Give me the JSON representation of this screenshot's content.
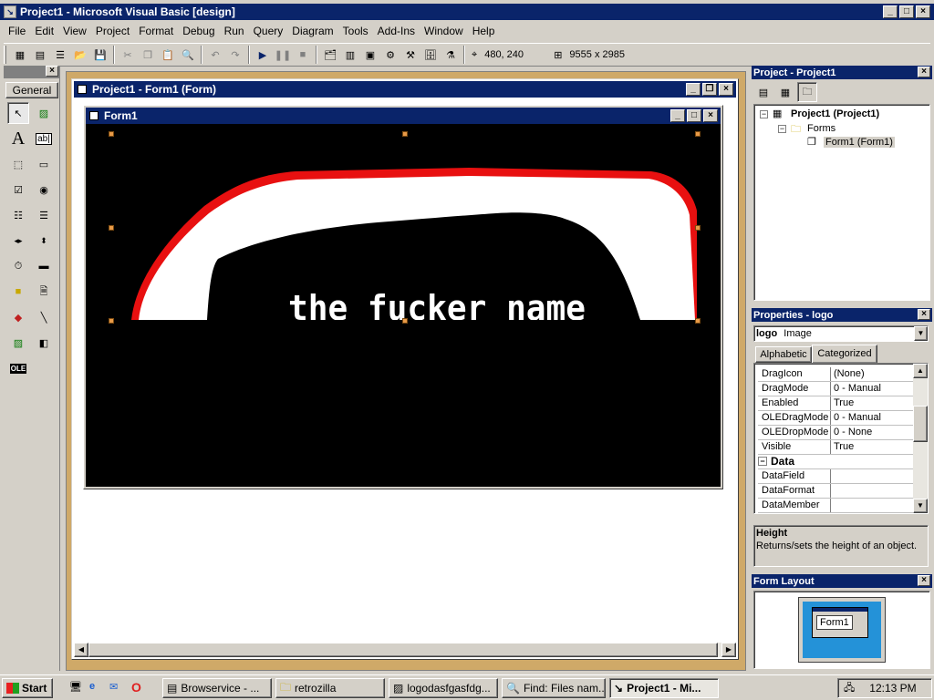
{
  "app": {
    "title": "Project1 - Microsoft Visual Basic [design]"
  },
  "menu": [
    "File",
    "Edit",
    "View",
    "Project",
    "Format",
    "Debug",
    "Run",
    "Query",
    "Diagram",
    "Tools",
    "Add-Ins",
    "Window",
    "Help"
  ],
  "toolbar": {
    "position": "480, 240",
    "size": "9555 x 2985"
  },
  "toolbox": {
    "tab_label": "General"
  },
  "project_window": {
    "title": "Project1 - Form1 (Form)",
    "form_title": "Form1",
    "logo_text": "the fucker name"
  },
  "project_explorer": {
    "title": "Project - Project1",
    "root": "Project1 (Project1)",
    "folder": "Forms",
    "form": "Form1 (Form1)"
  },
  "properties": {
    "title": "Properties - logo",
    "object_name": "logo",
    "object_type": "Image",
    "tab_alpha": "Alphabetic",
    "tab_cat": "Categorized",
    "rows": [
      {
        "name": "DragIcon",
        "value": "(None)"
      },
      {
        "name": "DragMode",
        "value": "0 - Manual"
      },
      {
        "name": "Enabled",
        "value": "True"
      },
      {
        "name": "OLEDragMode",
        "value": "0 - Manual"
      },
      {
        "name": "OLEDropMode",
        "value": "0 - None"
      },
      {
        "name": "Visible",
        "value": "True"
      }
    ],
    "category": "Data",
    "category_rows": [
      {
        "name": "DataField",
        "value": ""
      },
      {
        "name": "DataFormat",
        "value": ""
      },
      {
        "name": "DataMember",
        "value": ""
      }
    ],
    "desc_title": "Height",
    "desc_text": "Returns/sets the height of an object."
  },
  "form_layout": {
    "title": "Form Layout",
    "form_label": "Form1"
  },
  "taskbar": {
    "start": "Start",
    "tasks": [
      "Browservice - ...",
      "retrozilla",
      "logodasfgasfdg...",
      "Find: Files nam...",
      "Project1 - Mi..."
    ],
    "clock": "12:13 PM"
  },
  "colors": {
    "titlebar": "#0a246a",
    "mdi_bg": "#cfa968",
    "logo_red": "#e81010"
  }
}
